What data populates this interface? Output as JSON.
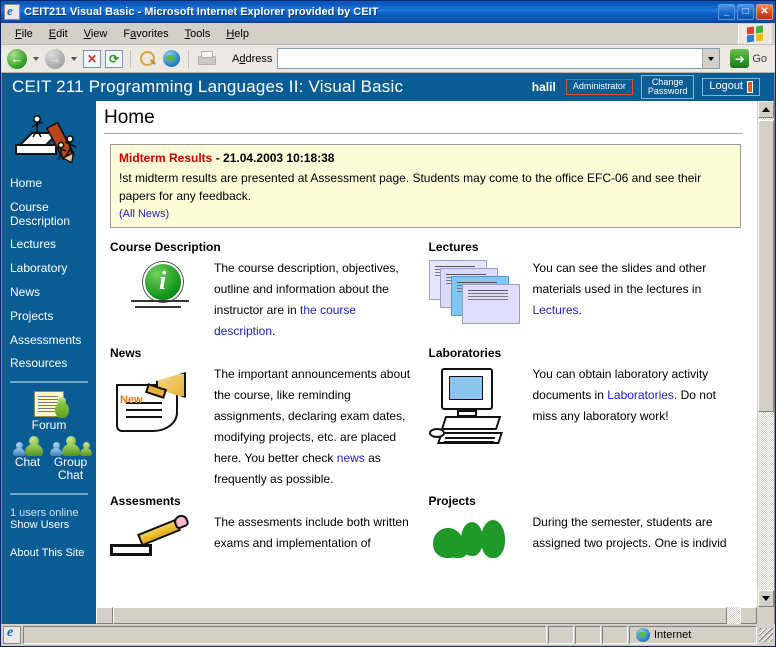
{
  "browser": {
    "title": "CEIT211 Visual Basic - Microsoft Internet Explorer provided by CEIT",
    "window_buttons": {
      "minimize": "_",
      "maximize": "□",
      "close": "✕"
    },
    "menu": [
      {
        "label": "File",
        "accel": "F"
      },
      {
        "label": "Edit",
        "accel": "E"
      },
      {
        "label": "View",
        "accel": "V"
      },
      {
        "label": "Favorites",
        "accel": "a"
      },
      {
        "label": "Tools",
        "accel": "T"
      },
      {
        "label": "Help",
        "accel": "H"
      }
    ],
    "toolbar": {
      "back": "Back",
      "forward": "Forward",
      "stop": "✕",
      "refresh": "⟳",
      "search": "Search",
      "favorites": "Favorites",
      "print": "Print",
      "address_label": "Address",
      "address_value": "",
      "address_placeholder": "",
      "go_label": "Go"
    },
    "status": {
      "text": "",
      "zone": "Internet"
    }
  },
  "page_header": {
    "title": "CEIT 211 Programming Languages II: Visual Basic",
    "user": "halil",
    "role_button": "Administrator",
    "change_password_line1": "Change",
    "change_password_line2": "Password",
    "logout_button": "Logout"
  },
  "sidebar": {
    "nav": [
      {
        "label": "Home"
      },
      {
        "label": "Course Description"
      },
      {
        "label": "Lectures"
      },
      {
        "label": "Laboratory"
      },
      {
        "label": "News"
      },
      {
        "label": "Projects"
      },
      {
        "label": "Assessments"
      },
      {
        "label": "Resources"
      }
    ],
    "forum_label": "Forum",
    "chat_label": "Chat",
    "group_chat_label": "Group Chat",
    "users_online": "1 users online",
    "show_users": "Show Users",
    "about": "About This Site"
  },
  "main": {
    "page_title": "Home",
    "news_box": {
      "title": "Midterm Results",
      "separator": " - ",
      "timestamp": "21.04.2003 10:18:38",
      "body": "!st midterm results are presented at Assessment page. Students may come to the office EFC-06 and see their papers for any feedback.",
      "all_news_link": "(All News)"
    },
    "sections": [
      {
        "heading": "Course Description",
        "icon": "info-icon",
        "text_before": "The course description, objectives, outline and information about the instructor are in ",
        "link": "the course description",
        "text_after": "."
      },
      {
        "heading": "Lectures",
        "icon": "slides-icon",
        "text_before": "You can see the slides and other materials used in the lectures in ",
        "link": "Lectures",
        "text_after": "."
      },
      {
        "heading": "News",
        "icon": "news-horn-icon",
        "text_before": "The important announcements about the course, like reminding assignments, declaring exam dates, modifying projects, etc. are placed here. You better check ",
        "link": "news",
        "text_after": " as frequently as possible."
      },
      {
        "heading": "Laboratories",
        "icon": "computer-icon",
        "text_before": "You can obtain laboratory activity documents in ",
        "link": "Laboratories",
        "text_after": ". Do not miss any laboratory work!"
      },
      {
        "heading": "Assesments",
        "icon": "pencil-icon",
        "text_before": "The assesments include both written exams and implementation of",
        "link": "",
        "text_after": ""
      },
      {
        "heading": "Projects",
        "icon": "trees-icon",
        "text_before": "During the semester, students are assigned two projects. One is individ",
        "link": "",
        "text_after": ""
      }
    ]
  },
  "colors": {
    "brand_blue": "#0a5c94",
    "news_bg": "#fdfbd8",
    "link": "#2020c0",
    "news_title_red": "#cc0000",
    "chrome": "#d4d0c8"
  }
}
